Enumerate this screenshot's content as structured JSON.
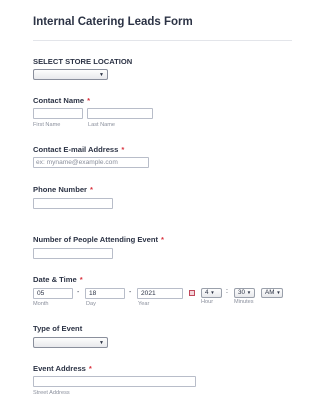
{
  "form": {
    "title": "Internal Catering Leads Form",
    "required_marker": "*",
    "store_location": {
      "label": "SELECT STORE LOCATION",
      "selected": ""
    },
    "contact_name": {
      "label": "Contact Name",
      "first_sub": "First Name",
      "last_sub": "Last Name",
      "first_value": "",
      "last_value": ""
    },
    "contact_email": {
      "label": "Contact E-mail Address",
      "placeholder": "ex: myname@example.com"
    },
    "phone": {
      "label": "Phone Number",
      "value": ""
    },
    "people": {
      "label": "Number of People Attending Event",
      "value": ""
    },
    "datetime": {
      "label": "Date & Time",
      "month": "05",
      "day": "18",
      "year": "2021",
      "month_sub": "Month",
      "day_sub": "Day",
      "year_sub": "Year",
      "separator": "-",
      "hour": "4",
      "minute": "30",
      "ampm": "AM",
      "hour_sub": "Hour",
      "minute_sub": "Minutes",
      "time_colon": ":"
    },
    "event_type": {
      "label": "Type of Event",
      "selected": ""
    },
    "event_address": {
      "label": "Event Address",
      "street_sub": "Street Address",
      "value": ""
    }
  },
  "icons": {
    "dropdown": "chevron-down-icon",
    "calendar": "calendar-icon"
  },
  "colors": {
    "required": "#d9333f",
    "text": "#2c3345",
    "border": "#b8bdc9"
  }
}
